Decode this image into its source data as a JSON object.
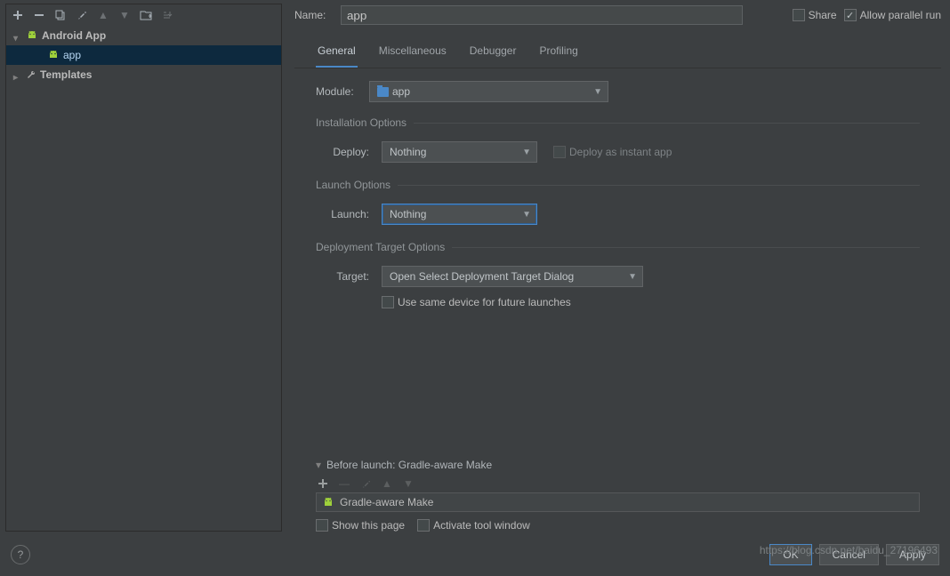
{
  "sidebar": {
    "items": [
      {
        "label": "Android App",
        "type": "group",
        "expanded": true
      },
      {
        "label": "app",
        "type": "config",
        "selected": true
      },
      {
        "label": "Templates",
        "type": "group",
        "expanded": false
      }
    ]
  },
  "header": {
    "name_label": "Name:",
    "name_value": "app",
    "share_label": "Share",
    "allow_parallel_label": "Allow parallel run",
    "share_checked": false,
    "allow_parallel_checked": true
  },
  "tabs": {
    "items": [
      "General",
      "Miscellaneous",
      "Debugger",
      "Profiling"
    ],
    "active": "General"
  },
  "general": {
    "module_label": "Module:",
    "module_value": "app",
    "install_section": "Installation Options",
    "deploy_label": "Deploy:",
    "deploy_value": "Nothing",
    "deploy_instant_label": "Deploy as instant app",
    "launch_section": "Launch Options",
    "launch_label": "Launch:",
    "launch_value": "Nothing",
    "deploy_target_section": "Deployment Target Options",
    "target_label": "Target:",
    "target_value": "Open Select Deployment Target Dialog",
    "use_same_device_label": "Use same device for future launches"
  },
  "before_launch": {
    "header": "Before launch: Gradle-aware Make",
    "item": "Gradle-aware Make",
    "show_page_label": "Show this page",
    "activate_tool_label": "Activate tool window"
  },
  "footer": {
    "ok": "OK",
    "cancel": "Cancel",
    "apply": "Apply"
  },
  "watermark": "https://blog.csdn.net/baidu_27196493"
}
